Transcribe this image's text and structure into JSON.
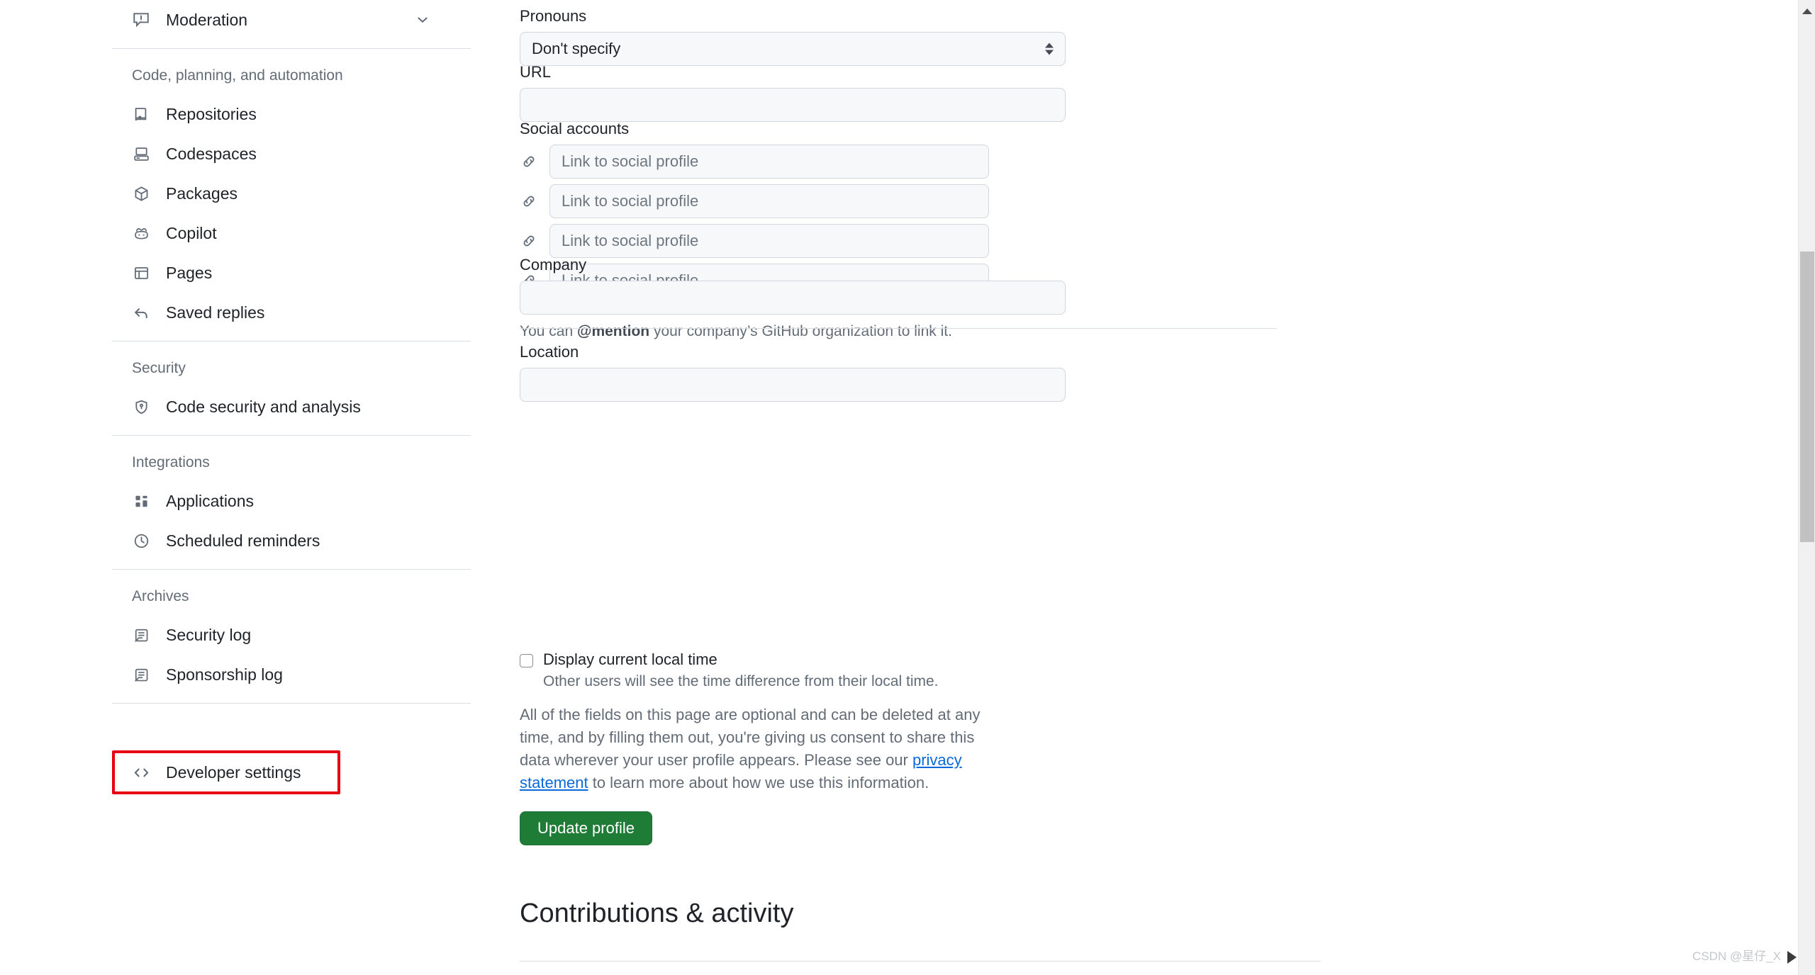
{
  "sidebar": {
    "moderation": {
      "label": "Moderation",
      "icon": "report-icon",
      "chevron": "chevron-down-icon"
    },
    "sections": [
      {
        "title": "Code, planning, and automation",
        "items": [
          {
            "label": "Repositories",
            "icon": "repo-icon"
          },
          {
            "label": "Codespaces",
            "icon": "codespaces-icon"
          },
          {
            "label": "Packages",
            "icon": "package-icon"
          },
          {
            "label": "Copilot",
            "icon": "copilot-icon"
          },
          {
            "label": "Pages",
            "icon": "browser-icon"
          },
          {
            "label": "Saved replies",
            "icon": "reply-icon"
          }
        ]
      },
      {
        "title": "Security",
        "items": [
          {
            "label": "Code security and analysis",
            "icon": "shield-lock-icon"
          }
        ]
      },
      {
        "title": "Integrations",
        "items": [
          {
            "label": "Applications",
            "icon": "apps-icon"
          },
          {
            "label": "Scheduled reminders",
            "icon": "clock-icon"
          }
        ]
      },
      {
        "title": "Archives",
        "items": [
          {
            "label": "Security log",
            "icon": "log-icon"
          },
          {
            "label": "Sponsorship log",
            "icon": "log-icon"
          }
        ]
      }
    ],
    "developer_settings": {
      "label": "Developer settings",
      "icon": "code-icon",
      "highlight_color": "#e60012"
    }
  },
  "main": {
    "pronouns": {
      "label": "Pronouns",
      "value": "Don't specify"
    },
    "url": {
      "label": "URL",
      "value": "",
      "placeholder": ""
    },
    "social": {
      "label": "Social accounts",
      "fields": [
        {
          "placeholder": "Link to social profile",
          "value": ""
        },
        {
          "placeholder": "Link to social profile",
          "value": ""
        },
        {
          "placeholder": "Link to social profile",
          "value": ""
        },
        {
          "placeholder": "Link to social profile",
          "value": ""
        }
      ]
    },
    "company": {
      "label": "Company",
      "value": "",
      "help_prefix": "You can ",
      "help_mention": "@mention",
      "help_suffix": " your company’s GitHub organization to link it."
    },
    "location": {
      "label": "Location",
      "value": ""
    },
    "local_time": {
      "label": "Display current local time",
      "sub": "Other users will see the time difference from their local time.",
      "checked": false
    },
    "consent": {
      "part1": "All of the fields on this page are optional and can be deleted at any time, and by filling them out, you're giving us consent to share this data wherever your user profile appears. Please see our ",
      "link": "privacy statement",
      "part2": " to learn more about how we use this information."
    },
    "update_button": "Update profile",
    "contributions_heading": "Contributions & activity"
  },
  "watermark": {
    "text": "CSDN @星仔_X"
  },
  "colors": {
    "accent_green": "#1f7c36",
    "link_blue": "#0969da",
    "highlight_red": "#e60012",
    "input_bg": "#f6f8fa",
    "border": "#d0d7de"
  }
}
